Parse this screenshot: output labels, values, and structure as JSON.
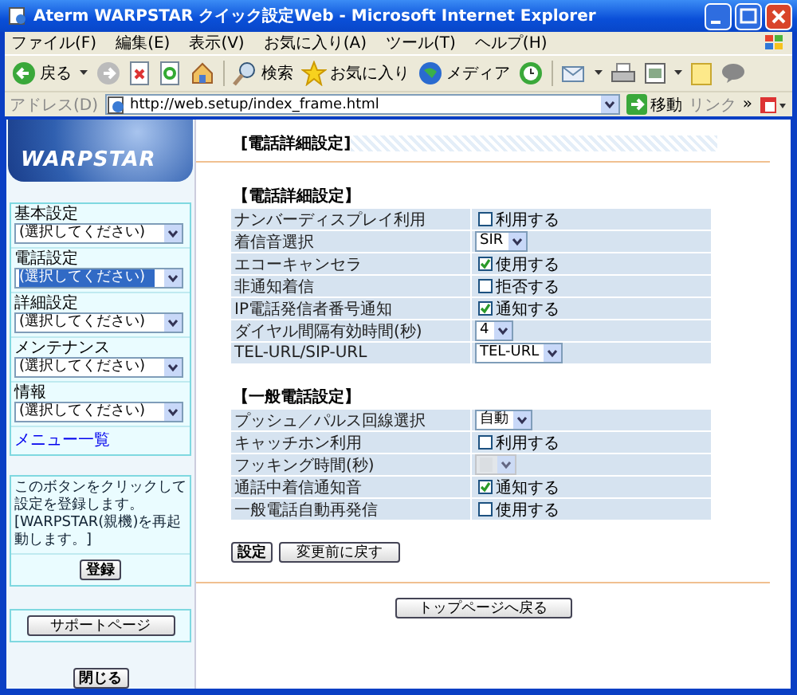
{
  "window": {
    "title": "Aterm WARPSTAR クイック設定Web - Microsoft Internet Explorer"
  },
  "menu_bar": [
    "ファイル(F)",
    "編集(E)",
    "表示(V)",
    "お気に入り(A)",
    "ツール(T)",
    "ヘルプ(H)"
  ],
  "toolbar": [
    "戻る",
    "検索",
    "お気に入り",
    "メディア"
  ],
  "address_bar": {
    "label": "アドレス(D)",
    "value": "http://web.setup/index_frame.html",
    "go": "移動",
    "links": "リンク",
    "chevron": "»"
  },
  "sidebar": {
    "logo": "WARPSTAR",
    "menus": [
      {
        "label": "基本設定",
        "value": "(選択してください)",
        "focused": false
      },
      {
        "label": "電話設定",
        "value": "(選択してください)",
        "focused": true
      },
      {
        "label": "詳細設定",
        "value": "(選択してください)",
        "focused": false
      },
      {
        "label": "メンテナンス",
        "value": "(選択してください)",
        "focused": false
      },
      {
        "label": "情報",
        "value": "(選択してください)",
        "focused": false
      }
    ],
    "menu_link": "メニュー一覧",
    "note": "このボタンをクリックして設定を登録します。[WARPSTAR(親機)を再起動します。]",
    "register": "登録",
    "support": "サポートページ",
    "close": "閉じる"
  },
  "main": {
    "title": "[電話詳細設定]",
    "sections": [
      {
        "title": "【電話詳細設定】",
        "rows": [
          {
            "label": "ナンバーディスプレイ利用",
            "kind": "checkbox",
            "text": "利用する",
            "checked": false
          },
          {
            "label": "着信音選択",
            "kind": "select",
            "value": "SIR",
            "disabled": false
          },
          {
            "label": "エコーキャンセラ",
            "kind": "checkbox",
            "text": "使用する",
            "checked": true
          },
          {
            "label": "非通知着信",
            "kind": "checkbox",
            "text": "拒否する",
            "checked": false
          },
          {
            "label": "IP電話発信者番号通知",
            "kind": "checkbox",
            "text": "通知する",
            "checked": true
          },
          {
            "label": "ダイヤル間隔有効時間(秒)",
            "kind": "select",
            "value": "4",
            "disabled": false
          },
          {
            "label": "TEL-URL/SIP-URL",
            "kind": "select",
            "value": "TEL-URL",
            "disabled": false
          }
        ]
      },
      {
        "title": "【一般電話設定】",
        "rows": [
          {
            "label": "プッシュ／パルス回線選択",
            "kind": "select",
            "value": "自動",
            "disabled": false
          },
          {
            "label": "キャッチホン利用",
            "kind": "checkbox",
            "text": "利用する",
            "checked": false
          },
          {
            "label": "フッキング時間(秒)",
            "kind": "select",
            "disabled": true
          },
          {
            "label": "通話中着信通知音",
            "kind": "checkbox",
            "text": "通知する",
            "checked": true
          },
          {
            "label": "一般電話自動再発信",
            "kind": "checkbox",
            "text": "使用する",
            "checked": false
          }
        ]
      }
    ],
    "buttons": [
      "設定",
      "変更前に戻す"
    ],
    "back": "トップページへ戻る"
  }
}
